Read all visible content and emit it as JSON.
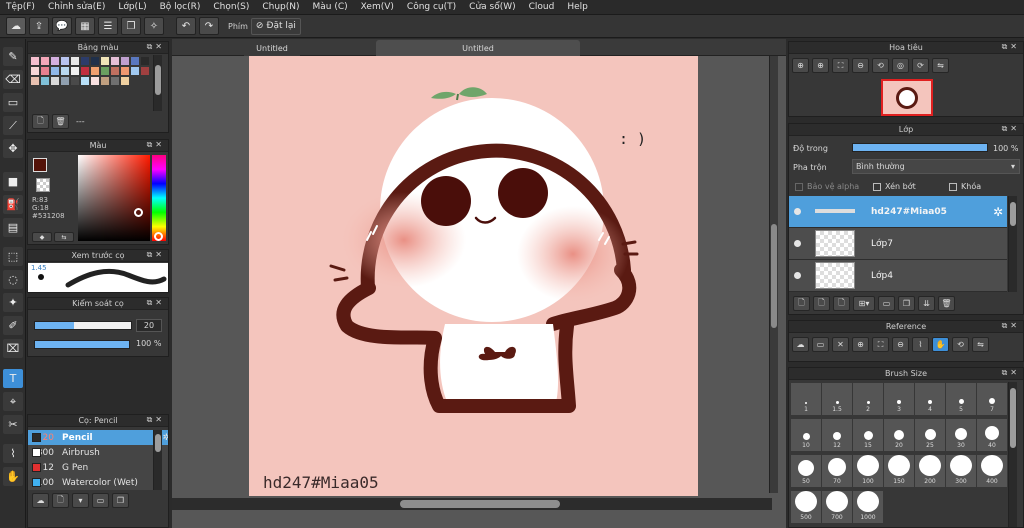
{
  "menu": [
    "Tệp(F)",
    "Chỉnh sửa(E)",
    "Lớp(L)",
    "Bộ lọc(R)",
    "Chọn(S)",
    "Chụp(N)",
    "Màu (C)",
    "Xem(V)",
    "Công cụ(T)",
    "Cửa sổ(W)",
    "Cloud",
    "Help"
  ],
  "toolbar": {
    "snap_label": "Phím",
    "reset_label": "Đặt lại"
  },
  "panels": {
    "palette_title": "Bảng màu",
    "palette_name": "---",
    "color_title": "Màu",
    "color_r": "R:83",
    "color_g": "G:18",
    "color_hex": "#531208",
    "brush_preview_title": "Xem trước cọ",
    "brush_preview_size": "1.45",
    "brush_control_title": "Kiểm soát cọ",
    "brush_size_value": "20",
    "brush_opacity_value": "100 %",
    "brush_list_title": "Cọ: Pencil"
  },
  "brushes": [
    {
      "size": "20",
      "name": "Pencil",
      "color": "#2a2a2a",
      "selected": true
    },
    {
      "size": "300",
      "name": "Airbrush",
      "color": "#ffffff",
      "selected": false
    },
    {
      "size": "12",
      "name": "G Pen",
      "color": "#e03030",
      "selected": false
    },
    {
      "size": "100",
      "name": "Watercolor (Wet)",
      "color": "#40b0f0",
      "selected": false
    }
  ],
  "tabs": [
    {
      "label": "Untitled"
    },
    {
      "label": "Untitled"
    }
  ],
  "canvas": {
    "face_text": ": )",
    "watermark": "hd247#Miaa05"
  },
  "navigator_title": "Hoa tiêu",
  "layers_panel": {
    "title": "Lớp",
    "opacity_label": "Độ trong",
    "opacity_value": "100 %",
    "opacity_fraction": 1.0,
    "blend_label": "Pha trộn",
    "blend_value": "Bình thường",
    "protect_alpha": "Bảo vệ alpha",
    "clipping": "Xén bớt",
    "lock": "Khóa",
    "layers": [
      {
        "name": "hd247#Miaa05",
        "selected": true
      },
      {
        "name": "Lớp7",
        "selected": false
      },
      {
        "name": "Lớp4",
        "selected": false
      }
    ]
  },
  "reference_title": "Reference",
  "brush_size_panel": {
    "title": "Brush Size",
    "sizes": [
      "1",
      "1.5",
      "2",
      "3",
      "4",
      "5",
      "7",
      "10",
      "12",
      "15",
      "20",
      "25",
      "30",
      "40",
      "50",
      "70",
      "100",
      "150",
      "200",
      "300",
      "400",
      "500",
      "700",
      "1000"
    ]
  },
  "colors": {
    "accent": "#4f9fdc",
    "current": "#531208",
    "canvas_bg": "#f4c5bd"
  }
}
